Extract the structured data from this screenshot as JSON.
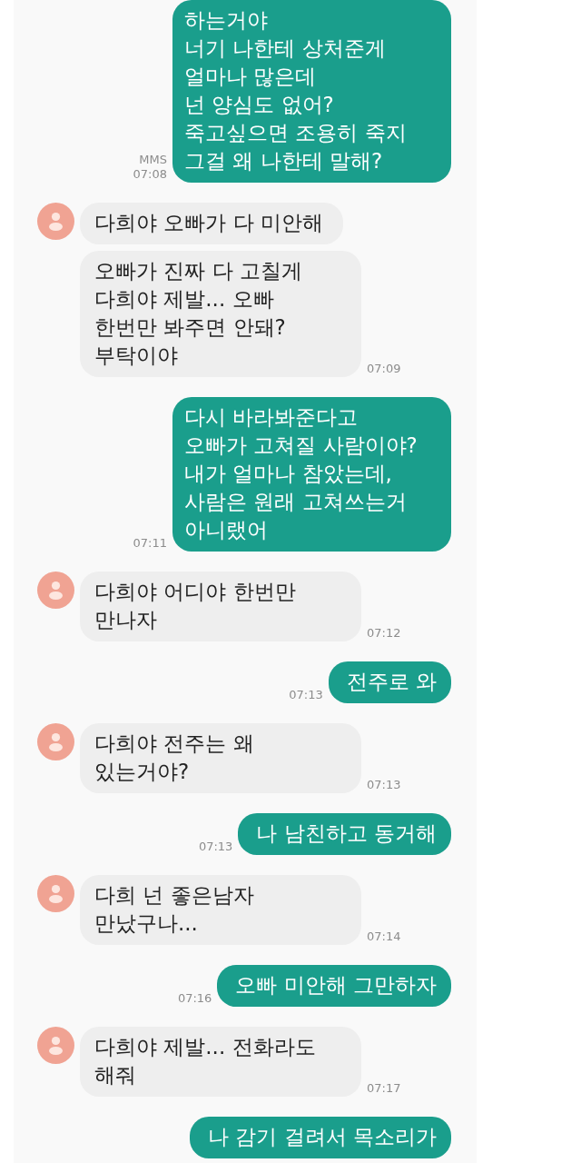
{
  "conversation": {
    "messages": [
      {
        "kind": "sent",
        "text": "하는거야\n너기 나한테 상처준게\n얼마나 많은데\n넌 양심도 없어?\n죽고싶으면 조용히 죽지\n그걸 왜 나한테 말해?",
        "type_label": "MMS",
        "time": "07:08"
      },
      {
        "kind": "received",
        "avatar": true,
        "text": "다희야 오빠가 다 미안해"
      },
      {
        "kind": "received",
        "avatar": false,
        "text": "오빠가 진짜 다 고칠게\n다희야 제발... 오빠\n한번만 봐주면 안돼?\n부탁이야",
        "time": "07:09"
      },
      {
        "kind": "sent",
        "text": "다시 바라봐준다고\n오빠가 고쳐질 사람이야?\n내가 얼마나 참았는데,\n사람은 원래 고쳐쓰는거\n아니랬어",
        "time": "07:11"
      },
      {
        "kind": "received",
        "avatar": true,
        "text": "다희야 어디야 한번만\n만나자",
        "time": "07:12"
      },
      {
        "kind": "sent",
        "text": "전주로 와",
        "time": "07:13"
      },
      {
        "kind": "received",
        "avatar": true,
        "text": "다희야 전주는 왜\n있는거야?",
        "time": "07:13"
      },
      {
        "kind": "sent",
        "text": "나 남친하고 동거해",
        "time": "07:13"
      },
      {
        "kind": "received",
        "avatar": true,
        "text": "다희 넌 좋은남자\n만났구나...",
        "time": "07:14"
      },
      {
        "kind": "sent",
        "text": "오빠 미안해 그만하자",
        "time": "07:16"
      },
      {
        "kind": "received",
        "avatar": true,
        "text": "다희야 제발... 전화라도\n해줘",
        "time": "07:17"
      },
      {
        "kind": "sent",
        "text": "나 감기 걸려서 목소리가"
      }
    ]
  }
}
